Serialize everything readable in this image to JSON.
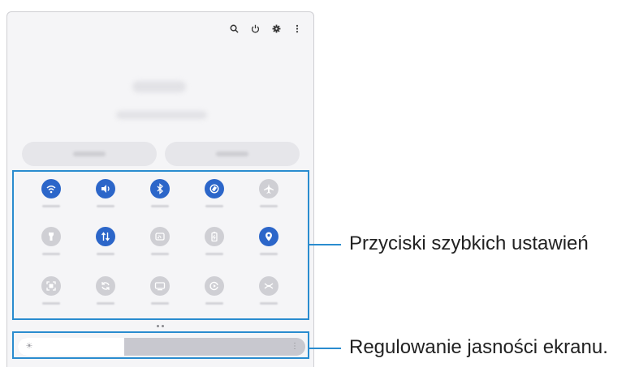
{
  "header": {
    "icons": [
      "search-icon",
      "power-icon",
      "gear-icon",
      "more-vert-icon"
    ]
  },
  "quick_settings": {
    "rows": [
      [
        {
          "icon": "wifi-icon",
          "state": "on"
        },
        {
          "icon": "sound-icon",
          "state": "on"
        },
        {
          "icon": "bluetooth-icon",
          "state": "on"
        },
        {
          "icon": "auto-rotate-icon",
          "state": "on"
        },
        {
          "icon": "airplane-icon",
          "state": "off"
        }
      ],
      [
        {
          "icon": "flashlight-icon",
          "state": "off"
        },
        {
          "icon": "mobile-data-icon",
          "state": "on"
        },
        {
          "icon": "cast-icon",
          "state": "off"
        },
        {
          "icon": "power-saving-icon",
          "state": "off"
        },
        {
          "icon": "location-icon",
          "state": "on"
        }
      ],
      [
        {
          "icon": "screen-capture-icon",
          "state": "off"
        },
        {
          "icon": "sync-icon",
          "state": "off"
        },
        {
          "icon": "dex-icon",
          "state": "off"
        },
        {
          "icon": "screen-recorder-icon",
          "state": "off"
        },
        {
          "icon": "nearby-share-icon",
          "state": "off"
        }
      ]
    ],
    "page_indicator": {
      "pages": 2,
      "current": 1
    }
  },
  "brightness": {
    "level": 0.37,
    "icon": "sun-icon"
  },
  "callouts": {
    "quick_settings": "Przyciski szybkich ustawień",
    "brightness": "Regulowanie jasności ekranu."
  },
  "colors": {
    "accent": "#2a8ccf",
    "tile_on": "#2c66c9",
    "tile_off": "#cfcfd4"
  }
}
